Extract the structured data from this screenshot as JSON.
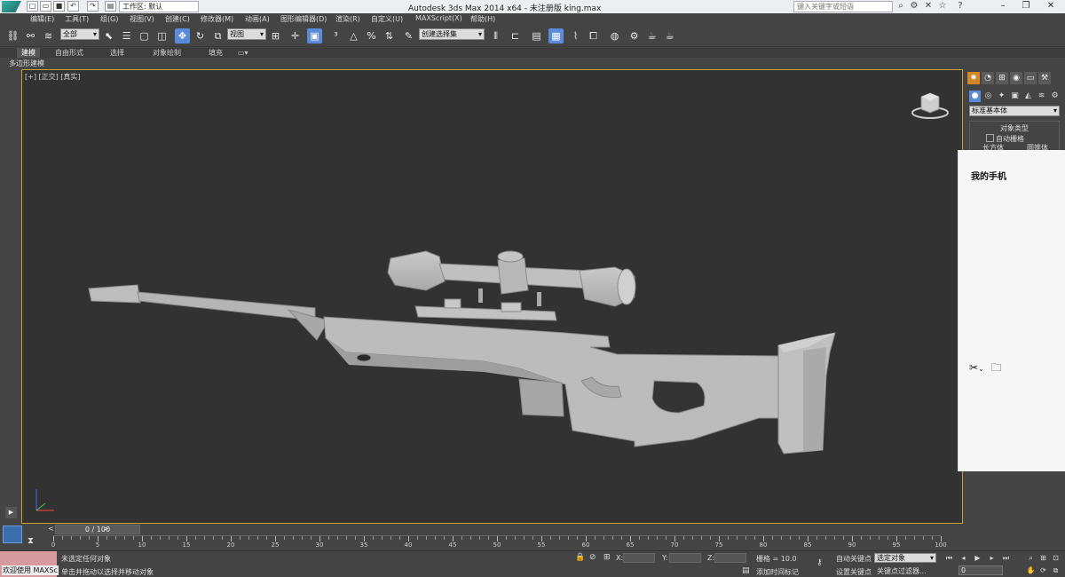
{
  "titlebar": {
    "workspace": "工作区: 默认",
    "window_title": "Autodesk 3ds Max  2014 x64    - 未注册版      king.max",
    "search_placeholder": "键入关键字或短语"
  },
  "menu": [
    "编辑(E)",
    "工具(T)",
    "组(G)",
    "视图(V)",
    "创建(C)",
    "修改器(M)",
    "动画(A)",
    "图形编辑器(D)",
    "渲染(R)",
    "自定义(U)",
    "MAXScript(X)",
    "帮助(H)"
  ],
  "toolbar": {
    "selection_filter": "全部",
    "reference_coord": "视图",
    "named_selection": "创建选择集"
  },
  "ribbon": {
    "tabs": [
      "建模",
      "自由形式",
      "选择",
      "对象绘制",
      "填充"
    ],
    "active_tab": "建模",
    "sub_label": "多边形建模"
  },
  "viewport": {
    "label": "[+] [正交] [真实]",
    "object": "sniper-rifle-model",
    "model_color": "#b9b9b9"
  },
  "command_panel": {
    "category": "标准基本体",
    "rollout_title": "对象类型",
    "autogrid": "自动栅格",
    "partial_buttons": [
      "长方体",
      "圆锥体"
    ]
  },
  "phone_overlay": {
    "title": "我的手机"
  },
  "timeline": {
    "slider": "0 / 100",
    "ticks": [
      "0",
      "5",
      "10",
      "15",
      "20",
      "25",
      "30",
      "35",
      "40",
      "45",
      "50",
      "55",
      "60",
      "65",
      "70",
      "75",
      "80",
      "85",
      "90",
      "95",
      "100"
    ]
  },
  "status": {
    "listener": "欢迎使用 MAXSc",
    "selection_msg": "未选定任何对象",
    "prompt_msg": "单击并拖动以选择并移动对象",
    "x_label": "X:",
    "y_label": "Y:",
    "z_label": "Z:",
    "grid": "栅格 = 10.0",
    "add_time_tag": "添加时间标记",
    "auto_key": "自动关键点",
    "set_key": "设置关键点",
    "key_mode": "选定对象",
    "key_filters": "关键点过滤器...",
    "frame": "0"
  },
  "colors": {
    "accent": "#5b8bd8",
    "viewport_border": "#c7a23a",
    "active_panel_tab": "#d0882a"
  }
}
